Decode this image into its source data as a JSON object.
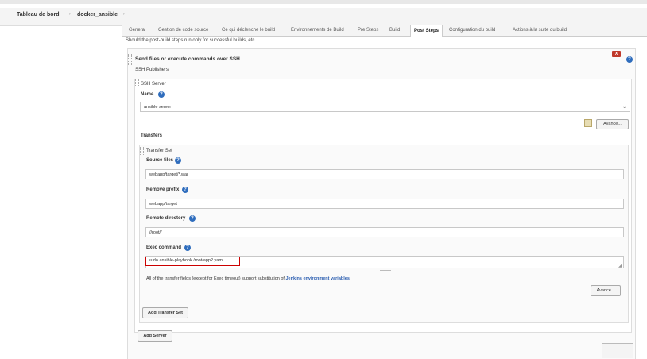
{
  "breadcrumb": {
    "home": "Tableau de bord",
    "job": "docker_ansible"
  },
  "tabs": [
    "General",
    "Gestion de code source",
    "Ce qui déclenche le build",
    "Environnements de Build",
    "Pre Steps",
    "Build",
    "Post Steps",
    "Configuration du build",
    "Actions à la suite du build"
  ],
  "active_tab": "Post Steps",
  "hint": "Should the post-build steps run only for successful builds, etc.",
  "ssh_section": {
    "title": "Send files or execute commands over SSH",
    "delete_label": "X",
    "publishers_label": "SSH Publishers",
    "server_label": "SSH Server",
    "name_label": "Name",
    "name_value": "ansible server",
    "advanced_label": "Avancé...",
    "transfers_label": "Transfers",
    "transfer_set": {
      "title": "Transfer Set",
      "source_files_label": "Source files",
      "source_files_value": "webapp/target/*.war",
      "remove_prefix_label": "Remove prefix",
      "remove_prefix_value": "webapp/target",
      "remote_directory_label": "Remote directory",
      "remote_directory_value": "//root//",
      "exec_command_label": "Exec command",
      "exec_command_value": "sudo ansible-playbook /root/app2.yaml",
      "note_prefix": "All of the transfer fields (except for Exec timeout) support substitution of",
      "note_link": "Jenkins environment variables",
      "advanced_label": "Avancé..."
    },
    "add_transfer_label": "Add Transfer Set",
    "add_server_label": "Add Server"
  },
  "colors": {
    "help": "#2f6dbd",
    "delete": "#c0392b",
    "highlight": "#cc0000"
  }
}
